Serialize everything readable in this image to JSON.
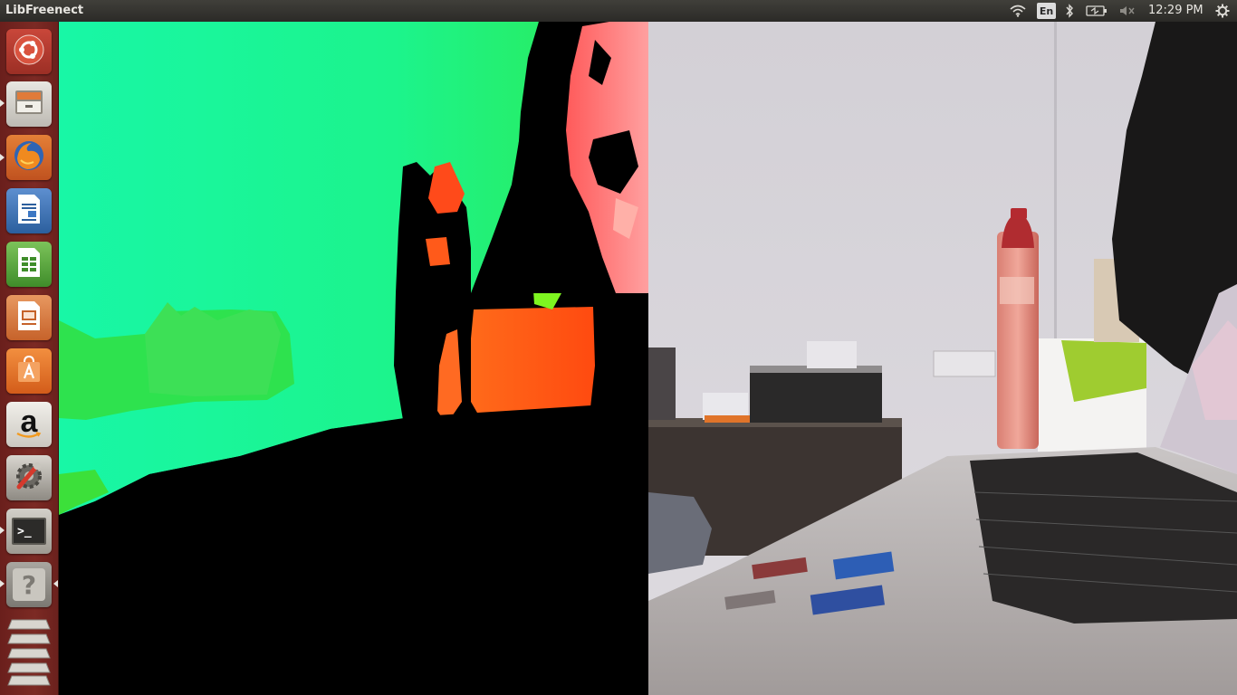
{
  "topbar": {
    "app_title": "LibFreenect",
    "keyboard_layout": "En",
    "clock": "12:29 PM",
    "indicators": [
      "wifi-icon",
      "keyboard-icon",
      "bluetooth-icon",
      "battery-icon",
      "volume-muted-icon",
      "gear-icon"
    ]
  },
  "launcher": {
    "items": [
      {
        "name": "ubuntu-dash",
        "icon": "ubuntu-logo-icon"
      },
      {
        "name": "files",
        "icon": "file-cabinet-icon"
      },
      {
        "name": "firefox",
        "icon": "firefox-icon"
      },
      {
        "name": "libreoffice-writer",
        "icon": "writer-icon"
      },
      {
        "name": "libreoffice-calc",
        "icon": "calc-icon"
      },
      {
        "name": "libreoffice-impress",
        "icon": "impress-icon"
      },
      {
        "name": "software-center",
        "icon": "shopping-bag-icon"
      },
      {
        "name": "amazon",
        "icon": "amazon-icon",
        "label": "a"
      },
      {
        "name": "system-settings",
        "icon": "wrench-gear-icon"
      },
      {
        "name": "terminal",
        "icon": "terminal-icon",
        "label": ">_"
      },
      {
        "name": "help",
        "icon": "help-icon",
        "label": "?"
      },
      {
        "name": "workspaces",
        "icon": "workspace-stack-icon"
      }
    ]
  },
  "views": {
    "depth": {
      "name": "depth-camera-view"
    },
    "rgb": {
      "name": "rgb-camera-view"
    }
  },
  "colors": {
    "depth_far": "#15f79e",
    "depth_mid": "#2be84a",
    "depth_near": "#ff5a1e",
    "depth_very_near": "#ff8080",
    "launcher_bg": "#7c2a24"
  }
}
